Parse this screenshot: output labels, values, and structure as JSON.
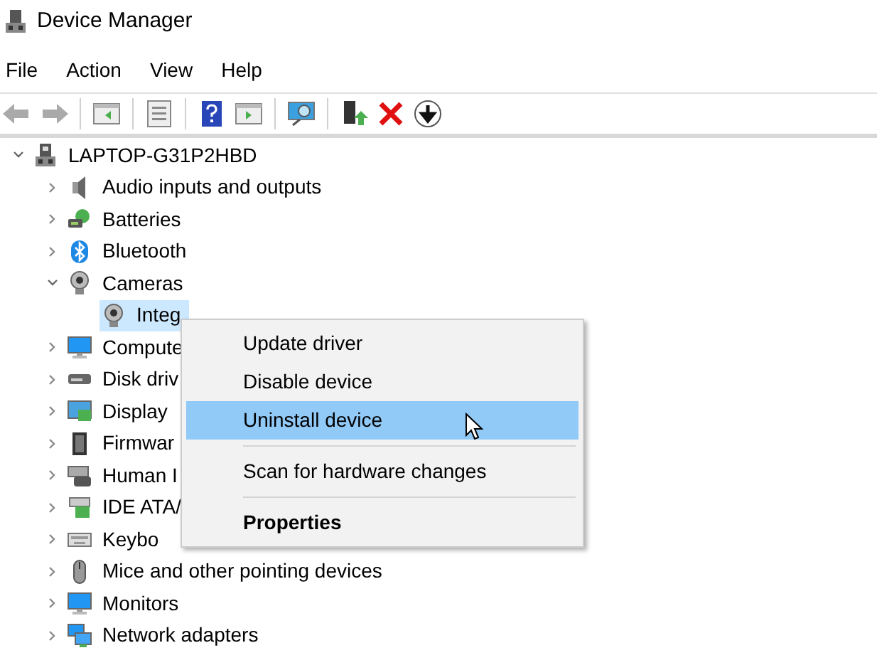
{
  "window": {
    "title": "Device Manager"
  },
  "menu_bar": [
    "File",
    "Action",
    "View",
    "Help"
  ],
  "tree": [
    {
      "label": "LAPTOP-G31P2HBD",
      "kind": "computer",
      "expanded": true,
      "selected": false,
      "children": [
        {
          "label": "Audio inputs and outputs",
          "kind": "audio",
          "expanded": false,
          "selected": false
        },
        {
          "label": "Batteries",
          "kind": "battery",
          "expanded": false,
          "selected": false
        },
        {
          "label": "Bluetooth",
          "kind": "bluetooth",
          "expanded": false,
          "selected": false
        },
        {
          "label": "Cameras",
          "kind": "camera",
          "expanded": true,
          "selected": false,
          "children": [
            {
              "label": "Integ",
              "kind": "camera",
              "selected": true
            }
          ]
        },
        {
          "label": "Compute",
          "kind": "monitor",
          "expanded": false,
          "selected": false
        },
        {
          "label": "Disk driv",
          "kind": "disk",
          "expanded": false,
          "selected": false
        },
        {
          "label": "Display",
          "kind": "display",
          "expanded": false,
          "selected": false
        },
        {
          "label": "Firmwar",
          "kind": "chip",
          "expanded": false,
          "selected": false
        },
        {
          "label": "Human I",
          "kind": "hid",
          "expanded": false,
          "selected": false
        },
        {
          "label": "IDE ATA/",
          "kind": "ide",
          "expanded": false,
          "selected": false
        },
        {
          "label": "Keybo",
          "kind": "keyboard",
          "expanded": false,
          "selected": false
        },
        {
          "label": "Mice and other pointing devices",
          "kind": "mouse",
          "expanded": false,
          "selected": false
        },
        {
          "label": "Monitors",
          "kind": "monitor",
          "expanded": false,
          "selected": false
        },
        {
          "label": "Network adapters",
          "kind": "network",
          "expanded": false,
          "selected": false
        }
      ]
    }
  ],
  "context_menu": [
    {
      "kind": "item",
      "label": "Update driver",
      "selected": false,
      "default": false
    },
    {
      "kind": "item",
      "label": "Disable device",
      "selected": false,
      "default": false
    },
    {
      "kind": "item",
      "label": "Uninstall device",
      "selected": true,
      "default": false
    },
    {
      "kind": "separator"
    },
    {
      "kind": "item",
      "label": "Scan for hardware changes",
      "selected": false,
      "default": false
    },
    {
      "kind": "separator"
    },
    {
      "kind": "item",
      "label": "Properties",
      "selected": false,
      "default": true
    }
  ]
}
